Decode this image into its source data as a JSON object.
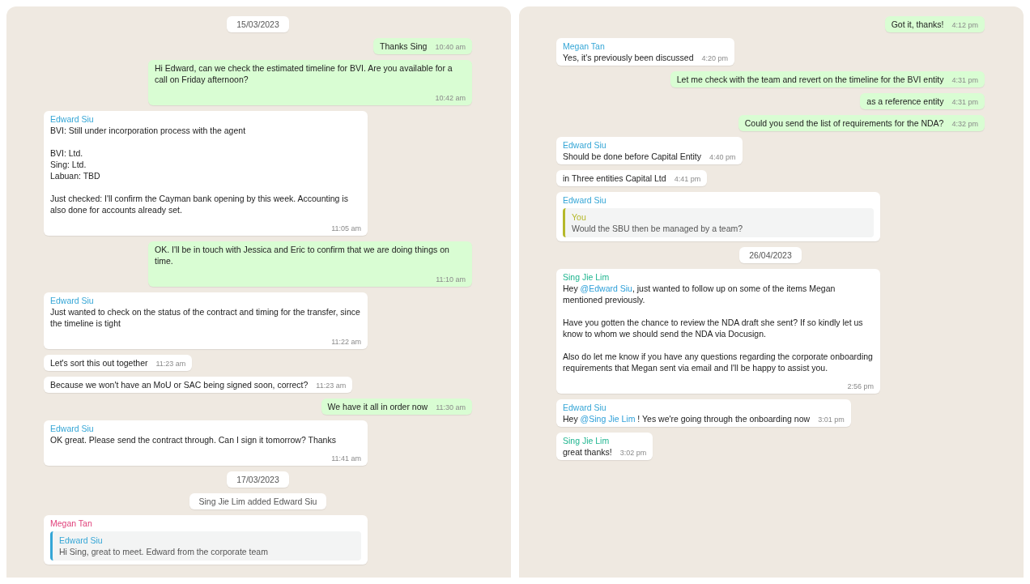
{
  "panels": [
    {
      "items": [
        {
          "kind": "date",
          "text": "15/03/2023"
        },
        {
          "kind": "out",
          "text": "Thanks Sing",
          "time": "10:40 am"
        },
        {
          "kind": "out",
          "text": "Hi Edward, can we check the estimated timeline for BVI. Are you available for a call on Friday afternoon?",
          "time": "10:42 am"
        },
        {
          "kind": "in",
          "sender": "Edward Siu",
          "color": "#35a6d6",
          "text": "BVI: Still under incorporation process with the agent\n\nBVI: Ltd.\nSing: Ltd.\nLabuan: TBD\n\nJust checked: I'll confirm the Cayman bank opening by this week. Accounting is also done for accounts already set.",
          "time": "11:05 am"
        },
        {
          "kind": "out",
          "text": "OK. I'll be in touch with Jessica and Eric to confirm that we are doing things on time.",
          "time": "11:10 am"
        },
        {
          "kind": "in",
          "sender": "Edward Siu",
          "color": "#35a6d6",
          "text": "Just wanted to check on the status of the contract and timing for the transfer, since the timeline is tight",
          "time": "11:22 am"
        },
        {
          "kind": "in",
          "text": "Let's sort this out together",
          "time": "11:23 am"
        },
        {
          "kind": "in",
          "text": "Because we won't have an MoU or SAC being signed soon, correct?",
          "time": "11:23 am"
        },
        {
          "kind": "out",
          "text": "We have it all in order now",
          "time": "11:30 am"
        },
        {
          "kind": "in",
          "sender": "Edward Siu",
          "color": "#35a6d6",
          "text": "OK great. Please send the contract through. Can I sign it tomorrow? Thanks",
          "time": "11:41 am"
        },
        {
          "kind": "date",
          "text": "17/03/2023"
        },
        {
          "kind": "date",
          "text": "Sing Jie Lim added Edward Siu"
        },
        {
          "kind": "in",
          "sender": "Megan Tan",
          "color": "#e0407a",
          "quote": {
            "sender": "Edward Siu",
            "color": "#35a6d6",
            "text": "Hi Sing, great to meet. Edward from the corporate team"
          }
        }
      ]
    },
    {
      "items": [
        {
          "kind": "out",
          "text": "Got it, thanks!",
          "time": "4:12 pm"
        },
        {
          "kind": "in",
          "sender": "Megan Tan",
          "color": "#35a6d6",
          "text": "Yes, it's previously been discussed",
          "time": "4:20 pm"
        },
        {
          "kind": "out",
          "text": "Let me check with the team and revert on the timeline for the BVI entity",
          "time": "4:31 pm"
        },
        {
          "kind": "out",
          "text": "as a reference entity",
          "time": "4:31 pm"
        },
        {
          "kind": "out",
          "text": "Could you send the list of requirements for the NDA?",
          "time": "4:32 pm"
        },
        {
          "kind": "in",
          "sender": "Edward Siu",
          "color": "#35a6d6",
          "text": "Should be done before Capital Entity",
          "time": "4:40 pm"
        },
        {
          "kind": "in",
          "text": "in Three entities Capital Ltd",
          "time": "4:41 pm"
        },
        {
          "kind": "in",
          "sender": "Edward Siu",
          "color": "#35a6d6",
          "quote": {
            "sender": "You",
            "color": "#b5b82a",
            "text": "Would the SBU then be managed by a team?"
          }
        },
        {
          "kind": "date",
          "text": "26/04/2023"
        },
        {
          "kind": "in",
          "sender": "Sing Jie Lim",
          "color": "#1fb58f",
          "segments": [
            {
              "text": "Hey "
            },
            {
              "text": "@Edward Siu",
              "mention": true
            },
            {
              "text": ", just wanted to follow up on some of the items Megan mentioned previously.\n\nHave you gotten the chance to review the NDA draft she sent? If so kindly let us know to whom we should send the NDA via Docusign.\n\nAlso do let me know if you have any questions regarding the corporate onboarding requirements that Megan sent via email and I'll be happy to assist you."
            }
          ],
          "time": "2:56 pm"
        },
        {
          "kind": "in",
          "sender": "Edward Siu",
          "color": "#35a6d6",
          "segments": [
            {
              "text": "Hey "
            },
            {
              "text": "@Sing Jie Lim",
              "mention": true
            },
            {
              "text": " ! Yes we're going through the onboarding now"
            }
          ],
          "time": "3:01 pm"
        },
        {
          "kind": "in",
          "sender": "Sing Jie Lim",
          "color": "#1fb58f",
          "text": "great thanks!",
          "time": "3:02 pm"
        }
      ]
    }
  ]
}
